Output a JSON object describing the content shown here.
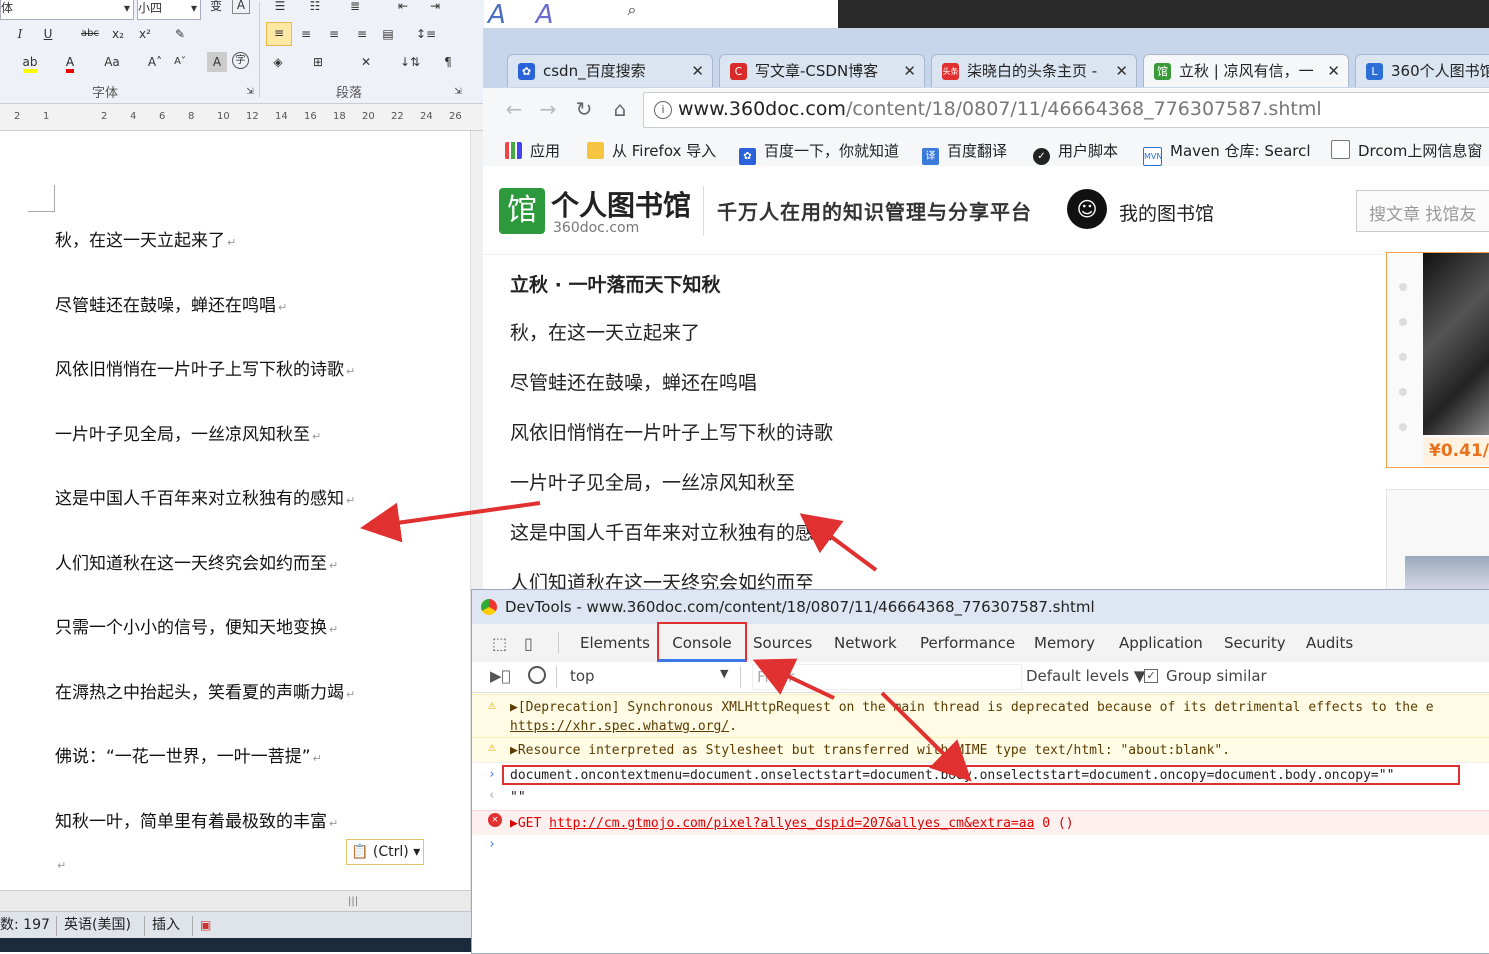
{
  "word": {
    "ribbon": {
      "font_size_value": "小四",
      "font_name_value": "体",
      "font_group_label": "字体",
      "paragraph_group_label": "段落",
      "ruler_ticks": [
        "2",
        "1",
        "",
        "2",
        "4",
        "6",
        "8",
        "10",
        "12",
        "14",
        "16",
        "18",
        "20",
        "22",
        "24",
        "26"
      ]
    },
    "document_lines": [
      "秋，在这一天立起来了",
      "尽管蛙还在鼓噪，蝉还在鸣唱",
      "风依旧悄悄在一片叶子上写下秋的诗歌",
      "一片叶子见全局，一丝凉风知秋至",
      "这是中国人千百年来对立秋独有的感知",
      "人们知道秋在这一天终究会如约而至",
      "只需一个小小的信号，便知天地变换",
      "在溽热之中抬起头，笑看夏的声嘶力竭",
      "佛说：“一花一世界，一叶一菩提”",
      "知秋一叶，简单里有着最极致的丰富"
    ],
    "paste_options_label": "(Ctrl)",
    "status": {
      "word_count": "数: 197",
      "language": "英语(美国)",
      "mode": "插入"
    }
  },
  "chrome": {
    "tabs": [
      {
        "title": "csdn_百度搜索",
        "icon": "baidu-paw-icon",
        "color": "#2b62d9"
      },
      {
        "title": "写文章-CSDN博客",
        "icon": "csdn-icon",
        "color": "#d92b2b"
      },
      {
        "title": "柒晓白的头条主页 -",
        "icon": "toutiao-icon",
        "color": "#e03030"
      },
      {
        "title": "立秋 | 凉风有信，一",
        "icon": "360doc-icon",
        "color": "#3a9a3a"
      },
      {
        "title": "360个人图书馆",
        "icon": "360doc-blue-icon",
        "color": "#2d6fd6"
      }
    ],
    "url": "www.360doc.com/content/18/0807/11/46664368_776307587.shtml",
    "url_host": "www.360doc.com",
    "url_path": "/content/18/0807/11/46664368_776307587.shtml",
    "bookmarks": [
      {
        "label": "应用",
        "icon": "apps-grid-icon"
      },
      {
        "label": "从 Firefox 导入",
        "icon": "folder-icon"
      },
      {
        "label": "百度一下，你就知道",
        "icon": "baidu-paw-icon"
      },
      {
        "label": "百度翻译",
        "icon": "translate-icon"
      },
      {
        "label": "用户脚本",
        "icon": "tampermonkey-icon"
      },
      {
        "label": "Maven 仓库: Searcl",
        "icon": "maven-icon"
      },
      {
        "label": "Drcom上网信息窗",
        "icon": "page-icon"
      }
    ],
    "site": {
      "logo_text": "个人图书馆",
      "logo_sub": "360doc.com",
      "slogan": "千万人在用的知识管理与分享平台",
      "my_library": "我的图书馆",
      "search_placeholder": "搜文章 找馆友"
    },
    "article": {
      "title": "立秋 · 一叶落而天下知秋",
      "lines": [
        "秋，在这一天立起来了",
        "尽管蛙还在鼓噪，蝉还在鸣唱",
        "风依旧悄悄在一片叶子上写下秋的诗歌",
        "一片叶子见全局，一丝凉风知秋至",
        "这是中国人千百年来对立秋独有的感知",
        "人们知道秋在这一天终究会如约而至"
      ]
    },
    "ad_price": "¥0.41/"
  },
  "devtools": {
    "title": "DevTools - www.360doc.com/content/18/0807/11/46664368_776307587.shtml",
    "tabs": [
      "Elements",
      "Console",
      "Sources",
      "Network",
      "Performance",
      "Memory",
      "Application",
      "Security",
      "Audits"
    ],
    "active_tab": "Console",
    "context": "top",
    "filter_placeholder": "Filter",
    "default_levels": "Default levels ▼",
    "group_similar": "Group similar",
    "console": {
      "warn1": "▶[Deprecation] Synchronous XMLHttpRequest on the main thread is deprecated because of its detrimental effects to the e",
      "warn1_link": "https://xhr.spec.whatwg.org/",
      "warn1_tail": ".",
      "warn2": "▶Resource interpreted as Stylesheet but transferred with MIME type text/html: \"about:blank\".",
      "input": "document.oncontextmenu=document.onselectstart=document.body.onselectstart=document.oncopy=document.body.oncopy=\"\"",
      "result": "\"\"",
      "error_prefix": "▶GET ",
      "error_link": "http://cm.gtmojo.com/pixel?allyes_dspid=207&allyes_cm&extra=aa",
      "error_suffix": " 0 ()"
    }
  },
  "colors": {
    "annotation": "#e03030",
    "word_ribbon": "#eef1f7",
    "chrome_tabstrip": "#c7d6ea"
  }
}
